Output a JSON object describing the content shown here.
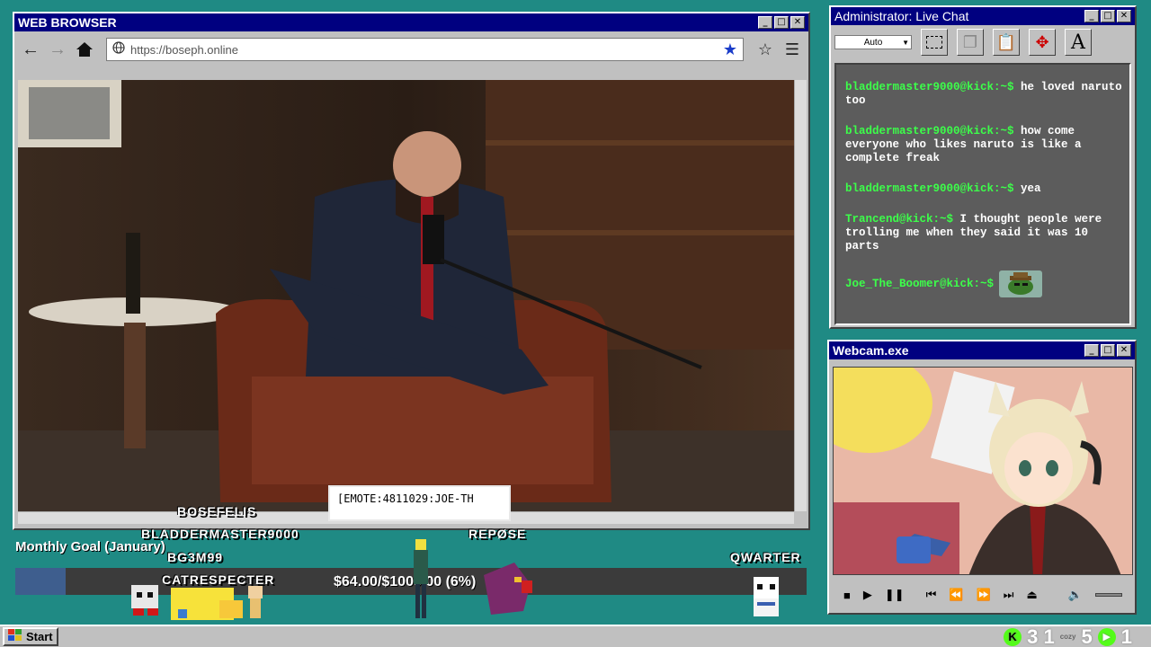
{
  "browser": {
    "title": "WEB BROWSER",
    "url": "https://boseph.online",
    "window_buttons": [
      "_",
      "□",
      "✕"
    ]
  },
  "chat": {
    "title": "Administrator: Live Chat",
    "dropdown_value": "Auto",
    "tool_text_label": "A",
    "messages": [
      {
        "user": "bladdermaster9000@kick:~$",
        "text": "he loved naruto too"
      },
      {
        "user": "bladdermaster9000@kick:~$",
        "text": "how come everyone who likes naruto is like a complete freak"
      },
      {
        "user": "bladdermaster9000@kick:~$",
        "text": "yea"
      },
      {
        "user": "Trancend@kick:~$",
        "text": "I thought people were trolling me when they said it was 10 parts"
      },
      {
        "user": "Joe_The_Boomer@kick:~$",
        "text": ""
      }
    ]
  },
  "webcam": {
    "title": "Webcam.exe"
  },
  "overlay": {
    "goal_title": "Monthly Goal (January)",
    "goal_amount": "$64.00/$1000.00 (6%)",
    "goal_fraction": 0.064,
    "emote_text": "[EMOTE:4811029:JOE-TH",
    "usernames": {
      "bosefelis": "BOSEFELIS",
      "bladdermaster": "BLADDERMASTER9000",
      "bg3m99": "BG3M99",
      "catrespecter": "CATRESPECTER",
      "repose": "REPØSE",
      "qwarter": "QWARTER"
    }
  },
  "taskbar": {
    "start_label": "Start",
    "tray_num_1": "3 1",
    "tray_num_2": "5",
    "tray_num_3": "1",
    "cozy_label": "cozy"
  },
  "colors": {
    "desktop": "#1f8a84",
    "titlebar": "#000080",
    "chat_user": "#3cff4a",
    "goal_fill": "#3e5e8e"
  }
}
